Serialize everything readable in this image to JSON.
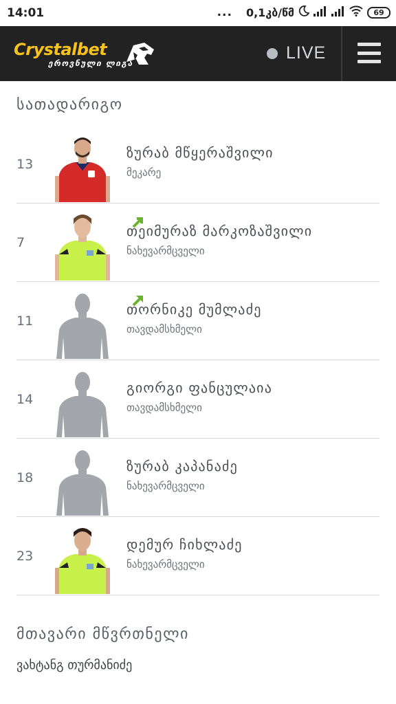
{
  "status_bar": {
    "time": "14:01",
    "dots": "...",
    "speed": "0,1კბ/წმ",
    "battery": "69"
  },
  "header": {
    "logo_text": "Crystalbet",
    "logo_sub": "ეროვნული ლიგა",
    "live_label": "LIVE"
  },
  "lineup": {
    "title": "სათადარიგო",
    "players": [
      {
        "number": "13",
        "name": "ზურაბ მწყერაშვილი",
        "position": "მეკარე",
        "photo": "red-kit-player",
        "subbed_in": false
      },
      {
        "number": "7",
        "name": "თეიმურაზ მარკოზაშვილი",
        "position": "ნახევარმცველი",
        "photo": "green-kit-player",
        "subbed_in": true
      },
      {
        "number": "11",
        "name": "თორნიკე მუმლაძე",
        "position": "თავდამსხმელი",
        "photo": "silhouette",
        "subbed_in": true
      },
      {
        "number": "14",
        "name": "გიორგი ფანცულაია",
        "position": "თავდამსხმელი",
        "photo": "silhouette",
        "subbed_in": false
      },
      {
        "number": "18",
        "name": "ზურაბ კაპანაძე",
        "position": "ნახევარმცველი",
        "photo": "silhouette",
        "subbed_in": false
      },
      {
        "number": "23",
        "name": "დემურ ჩიხლაძე",
        "position": "ნახევარმცველი",
        "photo": "green-kit-player",
        "subbed_in": false
      }
    ]
  },
  "coach": {
    "title": "მთავარი მწვრთნელი",
    "name": "ვახტანგ თურმანიძე"
  },
  "colors": {
    "header_bg": "#222222",
    "brand_yellow": "#f7c21b",
    "sub_arrow_green": "#6ab42d",
    "silhouette_gray": "#a3a6aa"
  }
}
